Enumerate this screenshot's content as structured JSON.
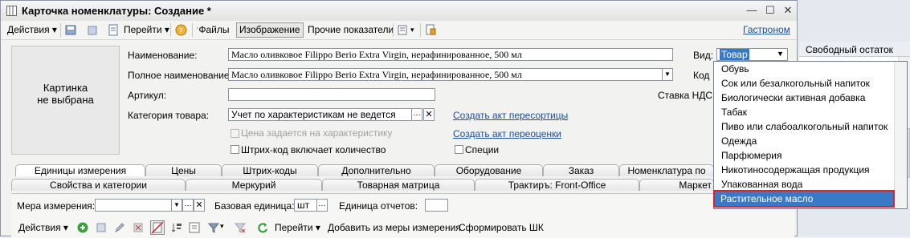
{
  "window": {
    "title": "Карточка номенклатуры: Создание *"
  },
  "toolbar": {
    "actions": "Действия",
    "goto": "Перейти",
    "files": "Файлы",
    "image": "Изображение",
    "other_indicators": "Прочие показатели",
    "gastronom": "Гастроном"
  },
  "picture": {
    "line1": "Картинка",
    "line2": "не выбрана"
  },
  "form": {
    "name_label": "Наименование:",
    "name_value": "Масло оливковое Filippo Berio Extra Virgin, нерафинированное, 500 мл",
    "fullname_label": "Полное наименование:",
    "fullname_value": "Масло оливковое Filippo Berio Extra Virgin, нерафинированное, 500 мл",
    "article_label": "Артикул:",
    "category_label": "Категория товара:",
    "category_value": "Учет по характеристикам не ведется",
    "create_resort": "Создать акт пересортицы",
    "create_revaluation": "Создать акт переоценки",
    "price_by_char": "Цена задается на характеристику",
    "barcode_qty": "Штрих-код включает количество",
    "spirits": "Специи",
    "kind_label": "Вид:",
    "kind_value": "Товар",
    "code_label": "Код",
    "vat_label": "Ставка НДС:"
  },
  "tabs_row1": [
    "Единицы измерения",
    "Цены",
    "Штрих-коды",
    "Дополнительно",
    "Оборудование",
    "Заказ",
    "Номенклатура по"
  ],
  "tabs_row2": [
    "Свойства и категории",
    "Меркурий",
    "Товарная матрица",
    "Трактиръ: Front-Office",
    "Маркет"
  ],
  "units_panel": {
    "measure_label": "Мера измерения:",
    "base_unit_label": "Базовая единица:",
    "base_unit_value": "шт",
    "report_unit_label": "Единица отчетов:",
    "actions": "Действия",
    "goto": "Перейти",
    "add_from_measure": "Добавить из меры измерения",
    "generate_barcode": "Сформировать ШК"
  },
  "dropdown": {
    "items": [
      "Обувь",
      "Сок или безалкогольный напиток",
      "Биологически активная добавка",
      "Табак",
      "Пиво или слабоалкогольный напиток",
      "Одежда",
      "Парфюмерия",
      "Никотиносодержащая продукция",
      "Упакованная вода"
    ],
    "selected": "Растительное масло"
  },
  "background": {
    "column_header": "Свободный остаток"
  },
  "colors": {
    "selection": "#3a78c8",
    "highlight_border": "#d9232e",
    "link": "#1a4fa0"
  }
}
